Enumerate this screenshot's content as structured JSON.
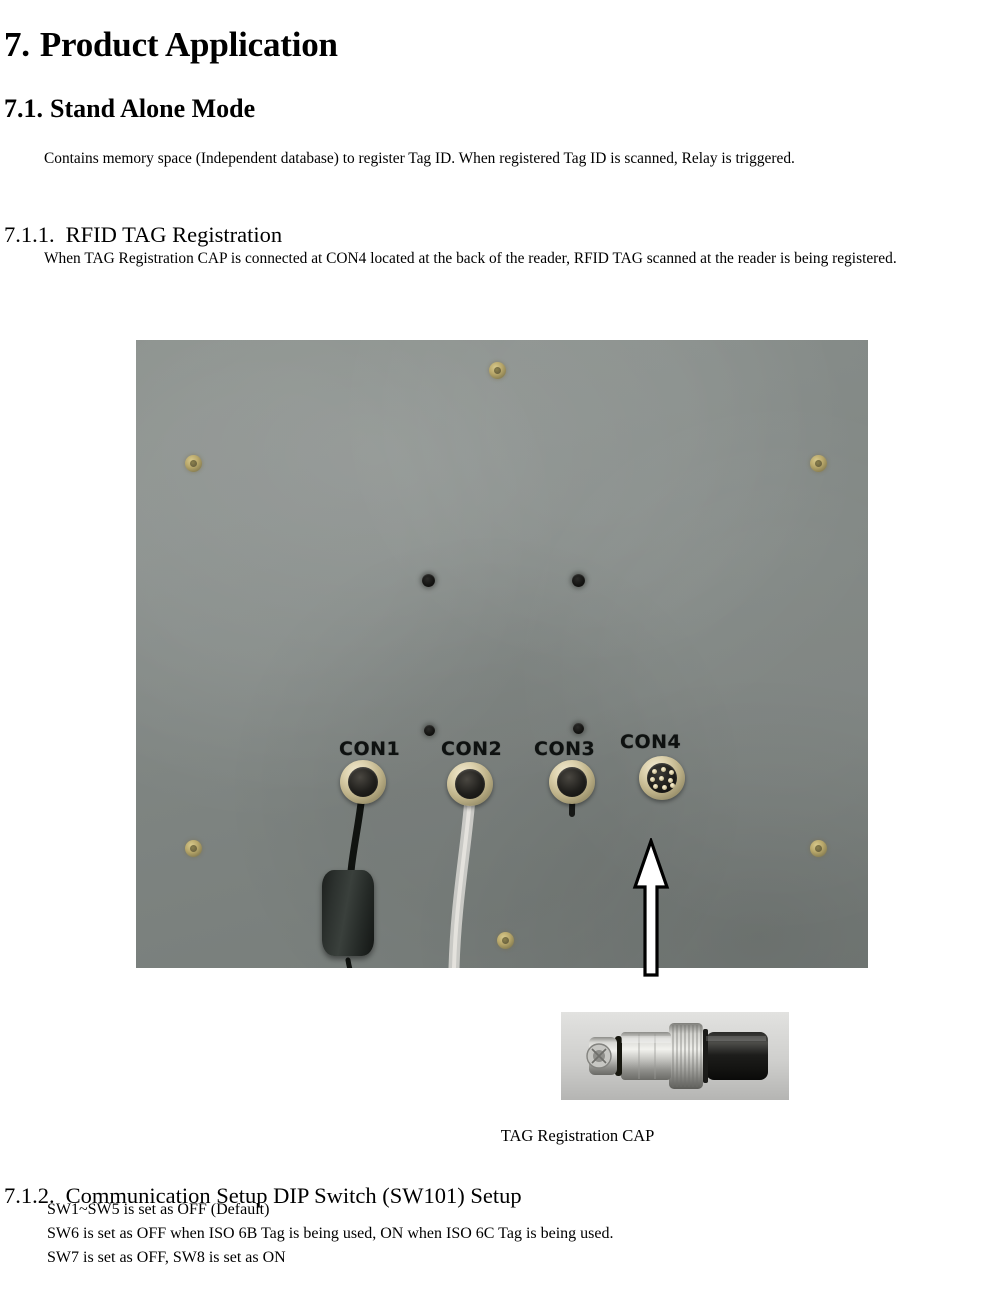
{
  "document": {
    "section_7": {
      "number": "7.",
      "title": "Product Application"
    },
    "section_7_1": {
      "number": "7.1.",
      "title": "Stand Alone Mode",
      "body": "Contains memory space (Independent database) to register Tag ID. When registered Tag ID is scanned, Relay is triggered."
    },
    "section_7_1_1": {
      "number": "7.1.1.",
      "title": "RFID TAG Registration",
      "body": "When TAG Registration CAP is connected at CON4 located at the back of the reader, RFID TAG scanned at the reader is being registered."
    },
    "figure_reader_back": {
      "alt": "Photograph of the back of the RFID reader showing four connectors",
      "connector_labels": [
        "CON1",
        "CON2",
        "CON3",
        "CON4"
      ]
    },
    "figure_arrow": {
      "alt": "up-arrow pointing from the TAG Registration CAP photo to CON4"
    },
    "figure_cap": {
      "alt": "Photograph of the TAG Registration CAP connector",
      "caption": "TAG Registration CAP"
    },
    "section_7_1_2": {
      "number": "7.1.2.",
      "title": "Communication Setup DIP Switch (SW101) Setup",
      "lines": [
        "SW1~SW5 is set as OFF (Default)",
        "SW6 is set as OFF when ISO 6B Tag is being used, ON when ISO 6C Tag is being used.",
        "SW7 is set as OFF, SW8 is set as ON"
      ]
    }
  },
  "colors": {
    "page_background": "#ffffff",
    "text": "#000000",
    "panel_gray": "#7e8481",
    "connector_brass": "#c8bb8e",
    "cap_photo_background": "#d2d2d0"
  }
}
